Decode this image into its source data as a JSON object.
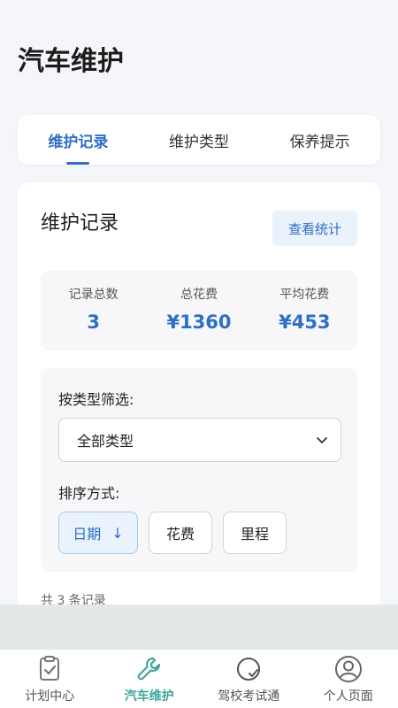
{
  "header": {
    "title": "汽车维护"
  },
  "tabs": [
    {
      "label": "维护记录",
      "active": true
    },
    {
      "label": "维护类型",
      "active": false
    },
    {
      "label": "保养提示",
      "active": false
    }
  ],
  "card": {
    "title": "维护记录",
    "stats_button": "查看统计",
    "summary": [
      {
        "label": "记录总数",
        "value": "3"
      },
      {
        "label": "总花费",
        "value": "¥1360"
      },
      {
        "label": "平均花费",
        "value": "¥453"
      }
    ],
    "filter": {
      "label": "按类型筛选:",
      "selected": "全部类型"
    },
    "sort": {
      "label": "排序方式:",
      "options": [
        {
          "label": "日期",
          "arrow": "↓",
          "active": true
        },
        {
          "label": "花费",
          "active": false
        },
        {
          "label": "里程",
          "active": false
        }
      ]
    },
    "record_count": "共 3 条记录"
  },
  "bottom_nav": [
    {
      "label": "计划中心",
      "icon": "checklist-icon",
      "active": false
    },
    {
      "label": "汽车维护",
      "icon": "wrench-icon",
      "active": true
    },
    {
      "label": "驾校考试通",
      "icon": "exam-icon",
      "active": false
    },
    {
      "label": "个人页面",
      "icon": "user-icon",
      "active": false
    }
  ],
  "colors": {
    "accent": "#2e6fc4",
    "nav_active": "#3fa79b",
    "background": "#f5f6fa"
  }
}
